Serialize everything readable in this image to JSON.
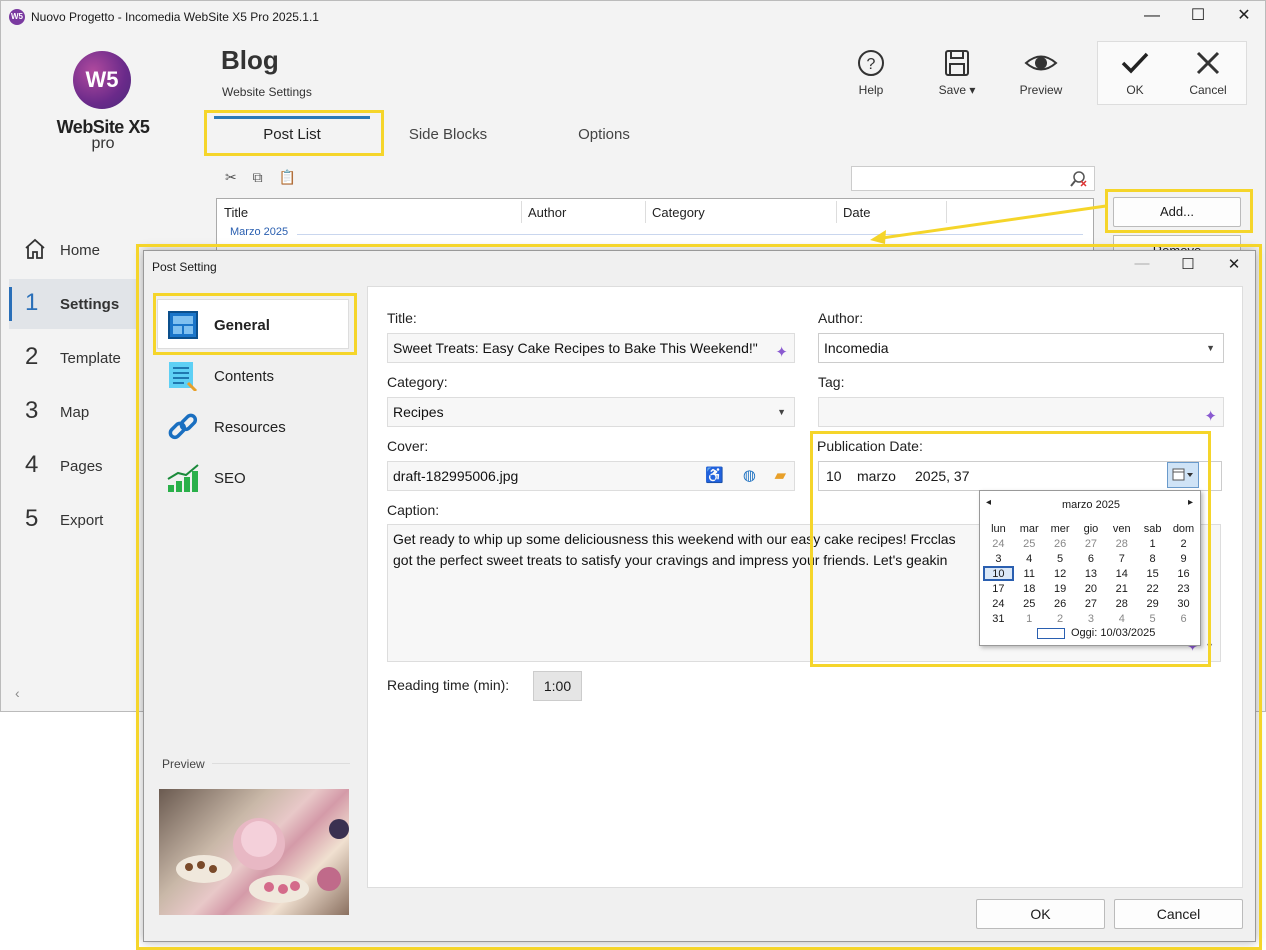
{
  "window": {
    "title": "Nuovo Progetto - Incomedia WebSite X5 Pro 2025.1.1",
    "app_icon": "W5",
    "minimize": "—",
    "maximize": "☐",
    "close": "✕"
  },
  "logo": {
    "mark": "W5",
    "name": "WebSite X5",
    "edition": "pro"
  },
  "nav": {
    "home": "Home",
    "items": [
      {
        "num": "1",
        "label": "Settings"
      },
      {
        "num": "2",
        "label": "Template"
      },
      {
        "num": "3",
        "label": "Map"
      },
      {
        "num": "4",
        "label": "Pages"
      },
      {
        "num": "5",
        "label": "Export"
      }
    ]
  },
  "header": {
    "title": "Blog",
    "subtitle": "Website Settings"
  },
  "toolbar": {
    "help": "Help",
    "save": "Save ▾",
    "preview": "Preview",
    "ok": "OK",
    "cancel": "Cancel"
  },
  "tabs": [
    "Post List",
    "Side Blocks",
    "Options"
  ],
  "post_list": {
    "columns": [
      "Title",
      "Author",
      "Category",
      "Date"
    ],
    "group": "Marzo 2025",
    "add_button": "Add...",
    "remove_button": "Remove"
  },
  "dialog": {
    "title": "Post Setting",
    "side_items": [
      "General",
      "Contents",
      "Resources",
      "SEO"
    ],
    "preview_label": "Preview",
    "labels": {
      "title": "Title:",
      "author": "Author:",
      "category": "Category:",
      "tag": "Tag:",
      "cover": "Cover:",
      "publication_date": "Publication Date:",
      "caption": "Caption:",
      "reading_time": "Reading time (min):"
    },
    "values": {
      "title": "Sweet Treats: Easy Cake Recipes to Bake This Weekend!\"",
      "author": "Incomedia",
      "category": "Recipes",
      "tag": "",
      "cover": "draft-182995006.jpg",
      "date_day": "10",
      "date_month": "marzo",
      "date_time": "2025,  37",
      "caption_line1": "Get ready to whip up some deliciousness this weekend with our easy cake recipes! Frcclas",
      "caption_line2": "got the perfect sweet treats to satisfy your cravings and impress your friends. Let's geakin",
      "reading_time": "1:00"
    },
    "ok": "OK",
    "cancel": "Cancel"
  },
  "calendar": {
    "month": "marzo 2025",
    "prev": "◂",
    "next": "▸",
    "weekdays": [
      "lun",
      "mar",
      "mer",
      "gio",
      "ven",
      "sab",
      "dom"
    ],
    "weeks": [
      [
        "24",
        "25",
        "26",
        "27",
        "28",
        "1",
        "2"
      ],
      [
        "3",
        "4",
        "5",
        "6",
        "7",
        "8",
        "9"
      ],
      [
        "10",
        "11",
        "12",
        "13",
        "14",
        "15",
        "16"
      ],
      [
        "17",
        "18",
        "19",
        "20",
        "21",
        "22",
        "23"
      ],
      [
        "24",
        "25",
        "26",
        "27",
        "28",
        "29",
        "30"
      ],
      [
        "31",
        "1",
        "2",
        "3",
        "4",
        "5",
        "6"
      ]
    ],
    "today_label": "Oggi: 10/03/2025"
  }
}
